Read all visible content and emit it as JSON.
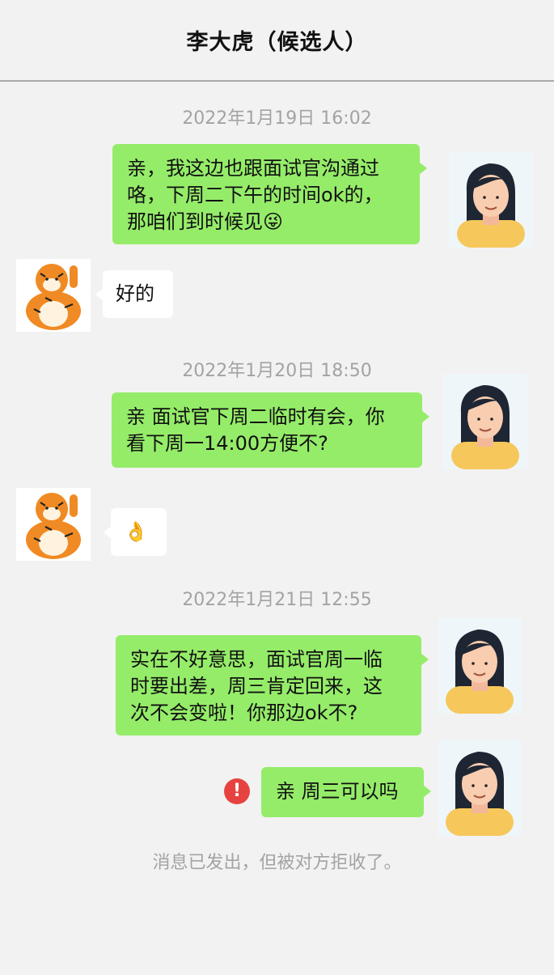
{
  "header": {
    "title": "李大虎（候选人）"
  },
  "messages": {
    "ts1": "2022年1月19日 16:02",
    "m1": [
      "亲，我这边也跟面试官沟通过",
      "咯，下周二下午的时间ok的，",
      "那咱们到时候见"
    ],
    "m1_emoji": "😜",
    "r1": "好的",
    "ts2": "2022年1月20日 18:50",
    "m2": [
      "亲 面试官下周二临时有会，你",
      "看下周一14:00方便不?"
    ],
    "r2": "👌",
    "ts3": "2022年1月21日 12:55",
    "m3": [
      "实在不好意思，面试官周一临",
      "时要出差，周三肯定回来，这",
      "次不会变啦！你那边ok不?"
    ],
    "m4": "亲 周三可以吗",
    "error_mark": "!",
    "notice": "消息已发出，但被对方拒收了。"
  },
  "colors": {
    "my_bubble": "#95ec69",
    "their_bubble": "#ffffff",
    "error": "#e64340",
    "background": "#f2f2f2"
  }
}
